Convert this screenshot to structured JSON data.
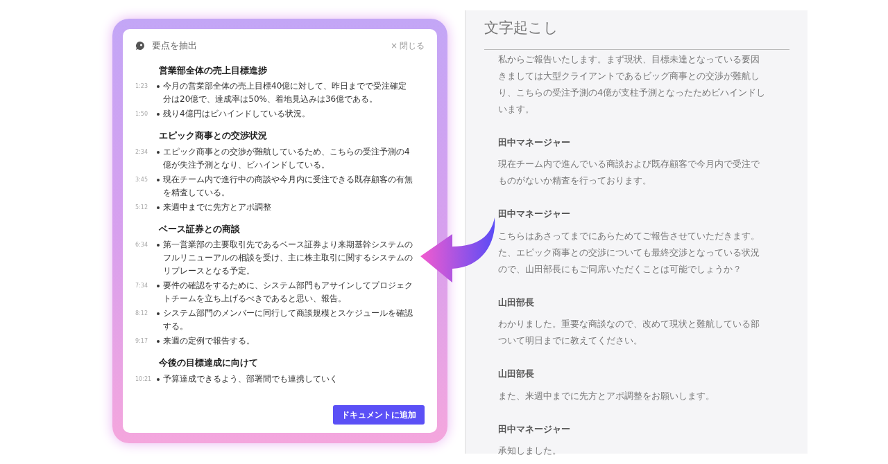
{
  "summary_panel": {
    "title": "要点を抽出",
    "close": {
      "icon": "×",
      "label": "閉じる"
    },
    "sections": [
      {
        "heading": "営業部全体の売上目標進捗",
        "items": [
          {
            "time": "1:23",
            "text": "今月の営業部全体の売上目標40億に対して、昨日までで受注確定分は20億で、達成率は50%、着地見込みは36億である。"
          },
          {
            "time": "1:50",
            "text": "残り4億円はビハインドしている状況。"
          }
        ]
      },
      {
        "heading": "エピック商事との交渉状況",
        "items": [
          {
            "time": "2:34",
            "text": "エピック商事との交渉が難航しているため、こちらの受注予測の4億が失注予測となり、ビハインドしている。"
          },
          {
            "time": "3:45",
            "text": "現在チーム内で進行中の商談や今月内に受注できる既存顧客の有無を精査している。"
          },
          {
            "time": "5:12",
            "text": "来週中までに先方とアポ調整"
          }
        ]
      },
      {
        "heading": "ベース証券との商談",
        "items": [
          {
            "time": "6:34",
            "text": "第一営業部の主要取引先であるベース証券より来期基幹システムのフルリニューアルの相談を受け、主に株主取引に関するシステムのリプレースとなる予定。"
          },
          {
            "time": "7:34",
            "text": "要件の確認をするために、システム部門もアサインしてプロジェクトチームを立ち上げるべきであると思い、報告。"
          },
          {
            "time": "8:12",
            "text": "システム部門のメンバーに同行して商談規模とスケジュールを確認する。"
          },
          {
            "time": "9:17",
            "text": "来週の定例で報告する。"
          }
        ]
      },
      {
        "heading": "今後の目標達成に向けて",
        "items": [
          {
            "time": "10:21",
            "text": "予算達成できるよう、部署間でも連携していく"
          }
        ]
      }
    ],
    "add_button": "ドキュメントに追加"
  },
  "transcript": {
    "title": "文字起こし",
    "entries": [
      {
        "lines": [
          "私からご報告いたします。まず現状、目標未達となっている要因",
          "きましては大型クライアントであるビッグ商事との交渉が難航し",
          "り、こちらの受注予測の4億が支柱予測となったためビハインドし",
          "います。"
        ]
      },
      {
        "speaker": "田中マネージャー",
        "lines": [
          "現在チーム内で進んでいる商談および既存顧客で今月内で受注で",
          "ものがないか精査を行っております。"
        ]
      },
      {
        "speaker": "田中マネージャー",
        "lines": [
          "こちらはあさってまでにあらためてご報告させていただきます。",
          "た、エピック商事との交渉についても最終交渉となっている状況",
          "ので、山田部長にもご同席いただくことは可能でしょうか？"
        ]
      },
      {
        "speaker": "山田部長",
        "lines": [
          "わかりました。重要な商談なので、改めて現状と難航している部",
          "ついて明日までに教えてください。"
        ]
      },
      {
        "speaker": "山田部長",
        "lines": [
          "また、来週中までに先方とアポ調整をお願いします。"
        ]
      },
      {
        "speaker": "田中マネージャー",
        "lines": [
          "承知しました。"
        ]
      }
    ]
  }
}
